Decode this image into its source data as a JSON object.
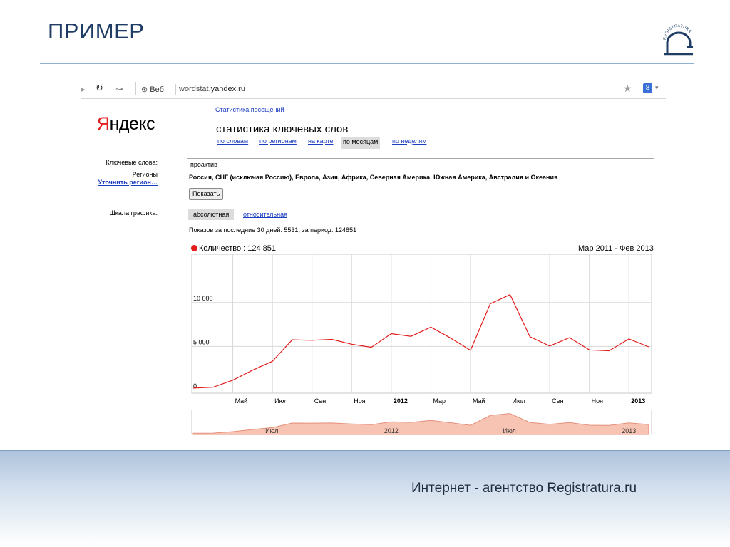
{
  "slide": {
    "title": "ПРИМЕР",
    "logo_text": "REGISTRATURA",
    "footer": "Интернет - агентство Registratura.ru"
  },
  "browser": {
    "search_engine": "Веб",
    "url_prefix": "wordstat.",
    "url_domain": "yandex.ru",
    "extension_badge": "8"
  },
  "yandex": {
    "logo_red": "Я",
    "logo_rest": "ндекс",
    "stats_link": "Статистика посещений",
    "title": "статистика ключевых слов",
    "tabs": [
      {
        "label": "по словам",
        "active": false
      },
      {
        "label": "по регионам",
        "active": false
      },
      {
        "label": "на карте",
        "active": false
      },
      {
        "label": "по месяцам",
        "active": true
      },
      {
        "label": "по неделям",
        "active": false
      }
    ],
    "keywords_label": "Ключевые слова:",
    "keywords_value": "проактив",
    "regions_label": "Регионы",
    "refine_link": "Уточнить регион…",
    "regions_value": "Россия, СНГ (исключая Россию), Европа, Азия, Африка, Северная Америка, Южная Америка, Австралия и Океания",
    "show_button": "Показать",
    "scale_label": "Шкала графика:",
    "scale_absolute": "абсолютная",
    "scale_relative": "относительная",
    "shows_text": "Показов за последние 30 дней: 5531, за период: 124851"
  },
  "chart_data": {
    "type": "line",
    "legend": "Количество : 124 851",
    "period": "Мар 2011 - Фев 2013",
    "series_color": "#e41c1c",
    "grid": true,
    "x": [
      "Мар 2011",
      "Апр 2011",
      "Май 2011",
      "Июн 2011",
      "Июл 2011",
      "Авг 2011",
      "Сен 2011",
      "Окт 2011",
      "Ноя 2011",
      "Дек 2011",
      "Янв 2012",
      "Фев 2012",
      "Мар 2012",
      "Апр 2012",
      "Май 2012",
      "Июн 2012",
      "Июл 2012",
      "Авг 2012",
      "Сен 2012",
      "Окт 2012",
      "Ноя 2012",
      "Дек 2012",
      "Янв 2013",
      "Фев 2013"
    ],
    "values": [
      250,
      350,
      1150,
      2300,
      3300,
      5750,
      5700,
      5800,
      5250,
      4900,
      6450,
      6150,
      7200,
      5950,
      4550,
      9850,
      10900,
      6100,
      5050,
      6000,
      4600,
      4500,
      5850,
      4950
    ],
    "x_tick_labels": [
      "Май",
      "Июл",
      "Сен",
      "Ноя",
      "2012",
      "Мар",
      "Май",
      "Июл",
      "Сен",
      "Ноя",
      "2013"
    ],
    "x_tick_bold": [
      false,
      false,
      false,
      false,
      true,
      false,
      false,
      false,
      false,
      false,
      true
    ],
    "y_ticks": [
      {
        "value": 0,
        "label": "0"
      },
      {
        "value": 5000,
        "label": "5 000"
      },
      {
        "value": 10000,
        "label": "10 000"
      }
    ],
    "ylim": [
      0,
      15500
    ],
    "navigator_labels": [
      "Июл",
      "2012",
      "Июл",
      "2013"
    ]
  }
}
